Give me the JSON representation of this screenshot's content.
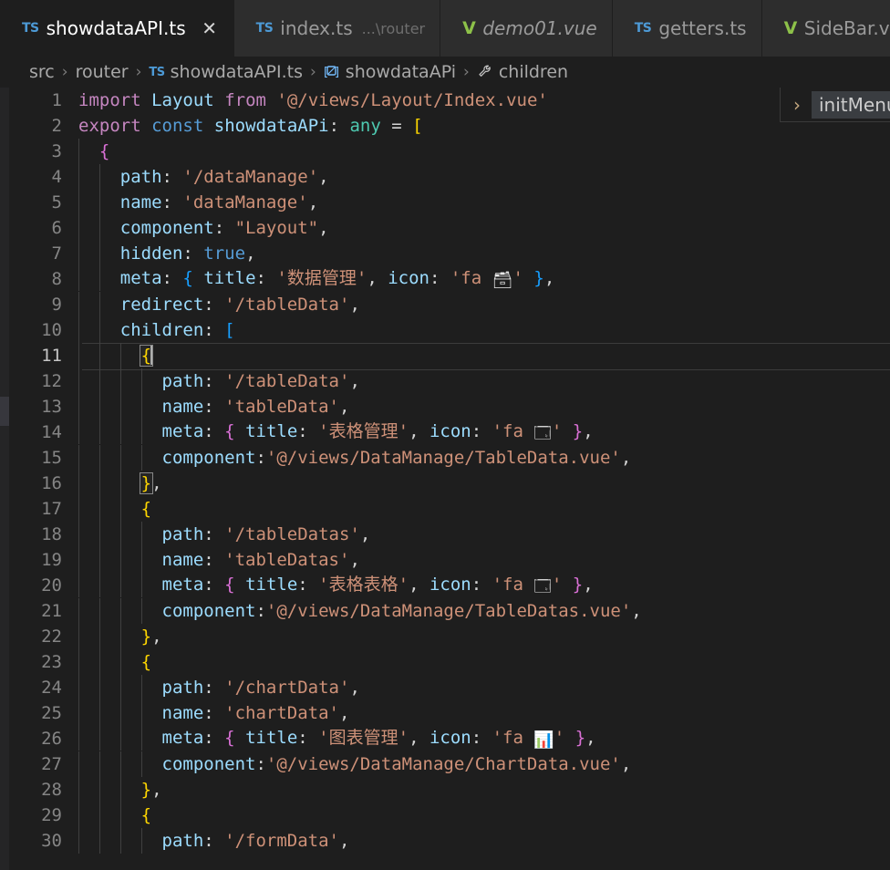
{
  "window": {
    "app": "Visual Studio Code",
    "theme_bg": "#1e1e1e",
    "accent": "#75beff"
  },
  "tabs": [
    {
      "icon": "typescript-file-icon",
      "icon_text": "TS",
      "icon_kind": "ts",
      "name": "showdataAPI.ts",
      "desc": "",
      "active": true,
      "italic": false,
      "close": "✕"
    },
    {
      "icon": "typescript-file-icon",
      "icon_text": "TS",
      "icon_kind": "ts",
      "name": "index.ts",
      "desc": "...\\router",
      "active": false,
      "italic": false,
      "close": ""
    },
    {
      "icon": "vue-file-icon",
      "icon_text": "V",
      "icon_kind": "vue",
      "name": "demo01.vue",
      "desc": "",
      "active": false,
      "italic": true,
      "close": ""
    },
    {
      "icon": "typescript-file-icon",
      "icon_text": "TS",
      "icon_kind": "ts",
      "name": "getters.ts",
      "desc": "",
      "active": false,
      "italic": false,
      "close": ""
    },
    {
      "icon": "vue-file-icon",
      "icon_text": "V",
      "icon_kind": "vue",
      "name": "SideBar.vue",
      "desc": "",
      "active": false,
      "italic": false,
      "close": ""
    }
  ],
  "breadcrumb": {
    "separator": "›",
    "items": [
      {
        "icon": "",
        "icon_kind": "none",
        "label": "src"
      },
      {
        "icon": "",
        "icon_kind": "none",
        "label": "router"
      },
      {
        "icon": "typescript-file-icon",
        "icon_text": "TS",
        "icon_kind": "ts",
        "label": "showdataAPI.ts"
      },
      {
        "icon": "variable-symbol-icon",
        "icon_text": "⬚",
        "icon_kind": "var",
        "label": "showdataAPi"
      },
      {
        "icon": "property-symbol-icon",
        "icon_text": "🔧",
        "icon_kind": "prop",
        "label": "children"
      }
    ]
  },
  "sticky_scroll": {
    "chevron": "›",
    "label": "initMenu"
  },
  "editor": {
    "language": "typescript",
    "cursor_line": 11,
    "first_line": 1,
    "last_line": 30,
    "lines": [
      {
        "n": "1",
        "indent": 0,
        "tokens": [
          {
            "c": "t-kw",
            "t": "import"
          },
          {
            "c": "t-pun",
            "t": " "
          },
          {
            "c": "t-var",
            "t": "Layout"
          },
          {
            "c": "t-pun",
            "t": " "
          },
          {
            "c": "t-kw",
            "t": "from"
          },
          {
            "c": "t-pun",
            "t": " "
          },
          {
            "c": "t-str",
            "t": "'@/views/Layout/Index.vue'"
          }
        ]
      },
      {
        "n": "2",
        "indent": 0,
        "tokens": [
          {
            "c": "t-kw",
            "t": "export"
          },
          {
            "c": "t-pun",
            "t": " "
          },
          {
            "c": "t-kw2",
            "t": "const"
          },
          {
            "c": "t-pun",
            "t": " "
          },
          {
            "c": "t-var",
            "t": "showdataAPi"
          },
          {
            "c": "t-pun",
            "t": ": "
          },
          {
            "c": "t-type",
            "t": "any"
          },
          {
            "c": "t-pun",
            "t": " = "
          },
          {
            "c": "t-br1",
            "t": "["
          }
        ]
      },
      {
        "n": "3",
        "indent": 1,
        "tokens": [
          {
            "c": "t-pun",
            "t": "  "
          },
          {
            "c": "t-br2",
            "t": "{"
          }
        ]
      },
      {
        "n": "4",
        "indent": 2,
        "tokens": [
          {
            "c": "t-pun",
            "t": "    "
          },
          {
            "c": "t-var",
            "t": "path"
          },
          {
            "c": "t-pun",
            "t": ": "
          },
          {
            "c": "t-str",
            "t": "'/dataManage'"
          },
          {
            "c": "t-pun",
            "t": ","
          }
        ]
      },
      {
        "n": "5",
        "indent": 2,
        "tokens": [
          {
            "c": "t-pun",
            "t": "    "
          },
          {
            "c": "t-var",
            "t": "name"
          },
          {
            "c": "t-pun",
            "t": ": "
          },
          {
            "c": "t-str",
            "t": "'dataManage'"
          },
          {
            "c": "t-pun",
            "t": ","
          }
        ]
      },
      {
        "n": "6",
        "indent": 2,
        "tokens": [
          {
            "c": "t-pun",
            "t": "    "
          },
          {
            "c": "t-var",
            "t": "component"
          },
          {
            "c": "t-pun",
            "t": ": "
          },
          {
            "c": "t-str",
            "t": "\"Layout\""
          },
          {
            "c": "t-pun",
            "t": ","
          }
        ]
      },
      {
        "n": "7",
        "indent": 2,
        "tokens": [
          {
            "c": "t-pun",
            "t": "    "
          },
          {
            "c": "t-var",
            "t": "hidden"
          },
          {
            "c": "t-pun",
            "t": ": "
          },
          {
            "c": "t-kw2",
            "t": "true"
          },
          {
            "c": "t-pun",
            "t": ","
          }
        ]
      },
      {
        "n": "8",
        "indent": 2,
        "tokens": [
          {
            "c": "t-pun",
            "t": "    "
          },
          {
            "c": "t-var",
            "t": "meta"
          },
          {
            "c": "t-pun",
            "t": ": "
          },
          {
            "c": "t-br3",
            "t": "{"
          },
          {
            "c": "t-pun",
            "t": " "
          },
          {
            "c": "t-var",
            "t": "title"
          },
          {
            "c": "t-pun",
            "t": ": "
          },
          {
            "c": "t-str",
            "t": "'数据管理'"
          },
          {
            "c": "t-pun",
            "t": ", "
          },
          {
            "c": "t-var",
            "t": "icon"
          },
          {
            "c": "t-pun",
            "t": ": "
          },
          {
            "c": "t-str",
            "t": "'fa "
          },
          {
            "c": "emoji",
            "t": "🗃"
          },
          {
            "c": "t-str",
            "t": "'"
          },
          {
            "c": "t-pun",
            "t": " "
          },
          {
            "c": "t-br3",
            "t": "}"
          },
          {
            "c": "t-pun",
            "t": ","
          }
        ]
      },
      {
        "n": "9",
        "indent": 2,
        "tokens": [
          {
            "c": "t-pun",
            "t": "    "
          },
          {
            "c": "t-var",
            "t": "redirect"
          },
          {
            "c": "t-pun",
            "t": ": "
          },
          {
            "c": "t-str",
            "t": "'/tableData'"
          },
          {
            "c": "t-pun",
            "t": ","
          }
        ]
      },
      {
        "n": "10",
        "indent": 2,
        "tokens": [
          {
            "c": "t-pun",
            "t": "    "
          },
          {
            "c": "t-var",
            "t": "children"
          },
          {
            "c": "t-pun",
            "t": ": "
          },
          {
            "c": "t-br3",
            "t": "["
          }
        ]
      },
      {
        "n": "11",
        "indent": 3,
        "current": true,
        "tokens": [
          {
            "c": "t-pun",
            "t": "      "
          },
          {
            "c": "t-br1 bracket-box",
            "t": "{"
          },
          {
            "c": "cursor",
            "t": ""
          }
        ]
      },
      {
        "n": "12",
        "indent": 4,
        "tokens": [
          {
            "c": "t-pun",
            "t": "        "
          },
          {
            "c": "t-var",
            "t": "path"
          },
          {
            "c": "t-pun",
            "t": ": "
          },
          {
            "c": "t-str",
            "t": "'/tableData'"
          },
          {
            "c": "t-pun",
            "t": ","
          }
        ]
      },
      {
        "n": "13",
        "indent": 4,
        "tokens": [
          {
            "c": "t-pun",
            "t": "        "
          },
          {
            "c": "t-var",
            "t": "name"
          },
          {
            "c": "t-pun",
            "t": ": "
          },
          {
            "c": "t-str",
            "t": "'tableData'"
          },
          {
            "c": "t-pun",
            "t": ","
          }
        ]
      },
      {
        "n": "14",
        "indent": 4,
        "tokens": [
          {
            "c": "t-pun",
            "t": "        "
          },
          {
            "c": "t-var",
            "t": "meta"
          },
          {
            "c": "t-pun",
            "t": ": "
          },
          {
            "c": "t-br2",
            "t": "{"
          },
          {
            "c": "t-pun",
            "t": " "
          },
          {
            "c": "t-var",
            "t": "title"
          },
          {
            "c": "t-pun",
            "t": ": "
          },
          {
            "c": "t-str",
            "t": "'表格管理'"
          },
          {
            "c": "t-pun",
            "t": ", "
          },
          {
            "c": "t-var",
            "t": "icon"
          },
          {
            "c": "t-pun",
            "t": ": "
          },
          {
            "c": "t-str",
            "t": "'fa "
          },
          {
            "c": "emoji",
            "t": "🗔"
          },
          {
            "c": "t-str",
            "t": "'"
          },
          {
            "c": "t-pun",
            "t": " "
          },
          {
            "c": "t-br2",
            "t": "}"
          },
          {
            "c": "t-pun",
            "t": ","
          }
        ]
      },
      {
        "n": "15",
        "indent": 4,
        "tokens": [
          {
            "c": "t-pun",
            "t": "        "
          },
          {
            "c": "t-var",
            "t": "component"
          },
          {
            "c": "t-pun",
            "t": ":"
          },
          {
            "c": "t-str",
            "t": "'@/views/DataManage/TableData.vue'"
          },
          {
            "c": "t-pun",
            "t": ","
          }
        ]
      },
      {
        "n": "16",
        "indent": 3,
        "tokens": [
          {
            "c": "t-pun",
            "t": "      "
          },
          {
            "c": "t-br1 bracket-box",
            "t": "}"
          },
          {
            "c": "t-pun",
            "t": ","
          }
        ]
      },
      {
        "n": "17",
        "indent": 3,
        "tokens": [
          {
            "c": "t-pun",
            "t": "      "
          },
          {
            "c": "t-br1",
            "t": "{"
          }
        ]
      },
      {
        "n": "18",
        "indent": 4,
        "tokens": [
          {
            "c": "t-pun",
            "t": "        "
          },
          {
            "c": "t-var",
            "t": "path"
          },
          {
            "c": "t-pun",
            "t": ": "
          },
          {
            "c": "t-str",
            "t": "'/tableDatas'"
          },
          {
            "c": "t-pun",
            "t": ","
          }
        ]
      },
      {
        "n": "19",
        "indent": 4,
        "tokens": [
          {
            "c": "t-pun",
            "t": "        "
          },
          {
            "c": "t-var",
            "t": "name"
          },
          {
            "c": "t-pun",
            "t": ": "
          },
          {
            "c": "t-str",
            "t": "'tableDatas'"
          },
          {
            "c": "t-pun",
            "t": ","
          }
        ]
      },
      {
        "n": "20",
        "indent": 4,
        "tokens": [
          {
            "c": "t-pun",
            "t": "        "
          },
          {
            "c": "t-var",
            "t": "meta"
          },
          {
            "c": "t-pun",
            "t": ": "
          },
          {
            "c": "t-br2",
            "t": "{"
          },
          {
            "c": "t-pun",
            "t": " "
          },
          {
            "c": "t-var",
            "t": "title"
          },
          {
            "c": "t-pun",
            "t": ": "
          },
          {
            "c": "t-str",
            "t": "'表格表格'"
          },
          {
            "c": "t-pun",
            "t": ", "
          },
          {
            "c": "t-var",
            "t": "icon"
          },
          {
            "c": "t-pun",
            "t": ": "
          },
          {
            "c": "t-str",
            "t": "'fa "
          },
          {
            "c": "emoji",
            "t": "🗔"
          },
          {
            "c": "t-str",
            "t": "'"
          },
          {
            "c": "t-pun",
            "t": " "
          },
          {
            "c": "t-br2",
            "t": "}"
          },
          {
            "c": "t-pun",
            "t": ","
          }
        ]
      },
      {
        "n": "21",
        "indent": 4,
        "tokens": [
          {
            "c": "t-pun",
            "t": "        "
          },
          {
            "c": "t-var",
            "t": "component"
          },
          {
            "c": "t-pun",
            "t": ":"
          },
          {
            "c": "t-str",
            "t": "'@/views/DataManage/TableDatas.vue'"
          },
          {
            "c": "t-pun",
            "t": ","
          }
        ]
      },
      {
        "n": "22",
        "indent": 3,
        "tokens": [
          {
            "c": "t-pun",
            "t": "      "
          },
          {
            "c": "t-br1",
            "t": "}"
          },
          {
            "c": "t-pun",
            "t": ","
          }
        ]
      },
      {
        "n": "23",
        "indent": 3,
        "tokens": [
          {
            "c": "t-pun",
            "t": "      "
          },
          {
            "c": "t-br1",
            "t": "{"
          }
        ]
      },
      {
        "n": "24",
        "indent": 4,
        "tokens": [
          {
            "c": "t-pun",
            "t": "        "
          },
          {
            "c": "t-var",
            "t": "path"
          },
          {
            "c": "t-pun",
            "t": ": "
          },
          {
            "c": "t-str",
            "t": "'/chartData'"
          },
          {
            "c": "t-pun",
            "t": ","
          }
        ]
      },
      {
        "n": "25",
        "indent": 4,
        "tokens": [
          {
            "c": "t-pun",
            "t": "        "
          },
          {
            "c": "t-var",
            "t": "name"
          },
          {
            "c": "t-pun",
            "t": ": "
          },
          {
            "c": "t-str",
            "t": "'chartData'"
          },
          {
            "c": "t-pun",
            "t": ","
          }
        ]
      },
      {
        "n": "26",
        "indent": 4,
        "tokens": [
          {
            "c": "t-pun",
            "t": "        "
          },
          {
            "c": "t-var",
            "t": "meta"
          },
          {
            "c": "t-pun",
            "t": ": "
          },
          {
            "c": "t-br2",
            "t": "{"
          },
          {
            "c": "t-pun",
            "t": " "
          },
          {
            "c": "t-var",
            "t": "title"
          },
          {
            "c": "t-pun",
            "t": ": "
          },
          {
            "c": "t-str",
            "t": "'图表管理'"
          },
          {
            "c": "t-pun",
            "t": ", "
          },
          {
            "c": "t-var",
            "t": "icon"
          },
          {
            "c": "t-pun",
            "t": ": "
          },
          {
            "c": "t-str",
            "t": "'fa "
          },
          {
            "c": "emoji",
            "t": "📊"
          },
          {
            "c": "t-str",
            "t": "'"
          },
          {
            "c": "t-pun",
            "t": " "
          },
          {
            "c": "t-br2",
            "t": "}"
          },
          {
            "c": "t-pun",
            "t": ","
          }
        ]
      },
      {
        "n": "27",
        "indent": 4,
        "tokens": [
          {
            "c": "t-pun",
            "t": "        "
          },
          {
            "c": "t-var",
            "t": "component"
          },
          {
            "c": "t-pun",
            "t": ":"
          },
          {
            "c": "t-str",
            "t": "'@/views/DataManage/ChartData.vue'"
          },
          {
            "c": "t-pun",
            "t": ","
          }
        ]
      },
      {
        "n": "28",
        "indent": 3,
        "tokens": [
          {
            "c": "t-pun",
            "t": "      "
          },
          {
            "c": "t-br1",
            "t": "}"
          },
          {
            "c": "t-pun",
            "t": ","
          }
        ]
      },
      {
        "n": "29",
        "indent": 3,
        "tokens": [
          {
            "c": "t-pun",
            "t": "      "
          },
          {
            "c": "t-br1",
            "t": "{"
          }
        ]
      },
      {
        "n": "30",
        "indent": 4,
        "tokens": [
          {
            "c": "t-pun",
            "t": "        "
          },
          {
            "c": "t-var",
            "t": "path"
          },
          {
            "c": "t-pun",
            "t": ": "
          },
          {
            "c": "t-str",
            "t": "'/formData'"
          },
          {
            "c": "t-pun",
            "t": ","
          }
        ]
      }
    ]
  }
}
